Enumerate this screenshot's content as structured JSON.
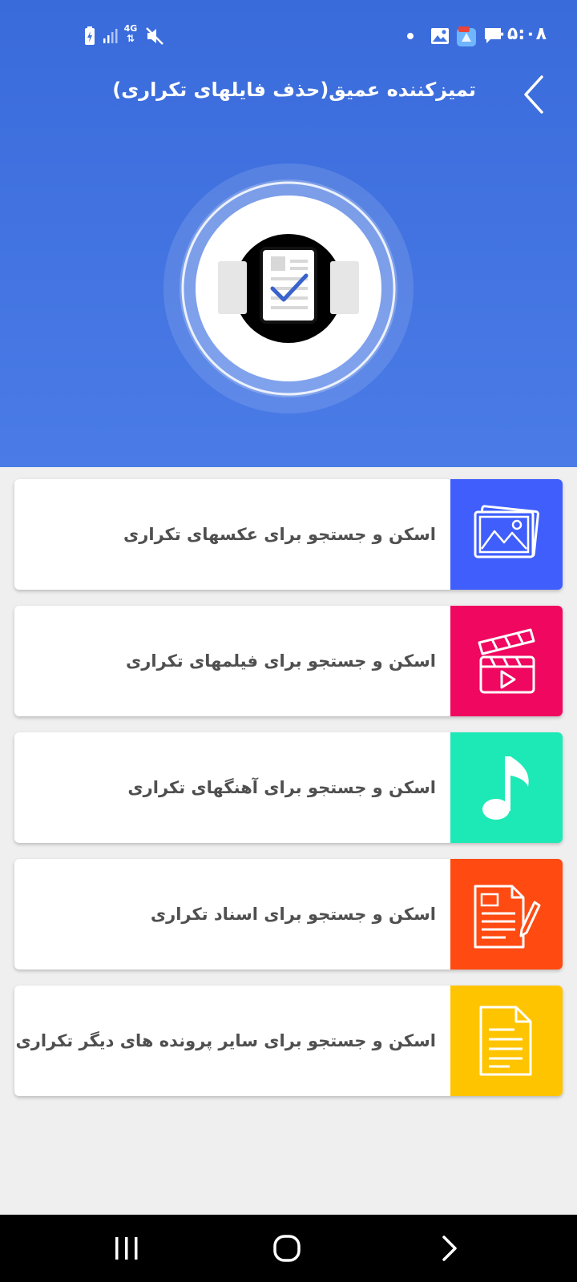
{
  "status_bar": {
    "time": "۰۵:۰۸",
    "notification_icons": [
      "chat-bubble-icon",
      "app-badge-icon",
      "gallery-icon",
      "dot-icon"
    ],
    "system_icons": [
      "mute-icon",
      "4g-data-icon",
      "signal-icon",
      "battery-charging-icon"
    ],
    "network_label": "4G"
  },
  "header": {
    "title": "تمیزکننده عمیق(حذف فایلهای تکراری)",
    "back_icon": "chevron-left-icon",
    "hero_icon": "document-check-icon",
    "color": "#3f72e0"
  },
  "cards": [
    {
      "label": "اسکن و جستجو برای عکسهای تکراری",
      "icon": "photo-icon",
      "color": "#3f5efb"
    },
    {
      "label": "اسکن و جستجو برای فیلمهای تکراری",
      "icon": "clapperboard-icon",
      "color": "#f0075f"
    },
    {
      "label": "اسکن و جستجو برای آهنگهای تکراری",
      "icon": "music-note-icon",
      "color": "#1de9b6"
    },
    {
      "label": "اسکن و جستجو برای اسناد تکراری",
      "icon": "document-pen-icon",
      "color": "#ff4a12"
    },
    {
      "label": "اسکن و جستجو برای سایر پرونده های دیگر تکراری",
      "icon": "file-icon",
      "color": "#ffc400"
    }
  ],
  "nav_bar": {
    "buttons": [
      "recent-apps-icon",
      "home-icon",
      "back-icon"
    ]
  }
}
